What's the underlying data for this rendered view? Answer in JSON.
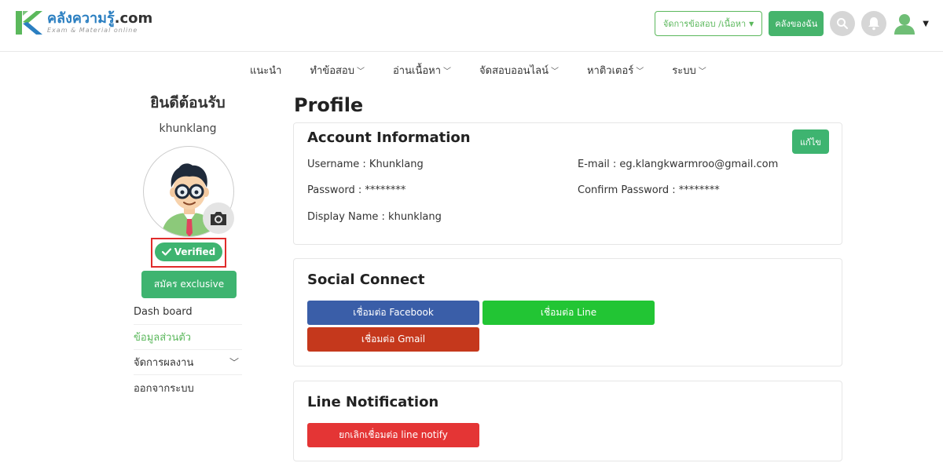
{
  "header": {
    "logo_title_part1": "คลัง",
    "logo_title_part2": "ความรู้",
    "logo_title_part3": ".com",
    "logo_subtitle": "Exam & Material online",
    "manage_button": "จัดการข้อสอบ /เนื้อหา",
    "my_store_button": "คลังของฉัน"
  },
  "nav": {
    "items": [
      {
        "label": "แนะนำ",
        "dropdown": false
      },
      {
        "label": "ทำข้อสอบ",
        "dropdown": true
      },
      {
        "label": "อ่านเนื้อหา",
        "dropdown": true
      },
      {
        "label": "จัดสอบออนไลน์",
        "dropdown": true
      },
      {
        "label": "หาติวเตอร์",
        "dropdown": true
      },
      {
        "label": "ระบบ",
        "dropdown": true
      }
    ]
  },
  "sidebar": {
    "welcome": "ยินดีต้อนรับ",
    "username": "khunklang",
    "verified": "Verified",
    "exclusive_button": "สมัคร exclusive",
    "menu": [
      {
        "label": "Dash board"
      },
      {
        "label": "ข้อมูลส่วนตัว"
      },
      {
        "label": "จัดการผลงาน"
      },
      {
        "label": "ออกจากระบบ"
      }
    ]
  },
  "main": {
    "title": "Profile",
    "account": {
      "title": "Account Information",
      "edit_button": "แก้ไข",
      "username": "Username : Khunklang",
      "password": "Password : ********",
      "display_name": "Display Name : khunklang",
      "email": "E-mail : eg.klangkwarmroo@gmail.com",
      "confirm_password": "Confirm Password : ********"
    },
    "social": {
      "title": "Social Connect",
      "facebook": "เชื่อมต่อ Facebook",
      "line": "เชื่อมต่อ Line",
      "gmail": "เชื่อมต่อ Gmail"
    },
    "line_notify": {
      "title": "Line Notification",
      "button": "ยกเลิกเชื่อมต่อ line notify"
    }
  },
  "colors": {
    "brand_green": "#3eb470",
    "brand_blue": "#2b7fc1",
    "facebook": "#3a5ea8",
    "line": "#22c534",
    "gmail": "#c5381c",
    "danger": "#e43535",
    "highlight_border": "#e02b2b"
  }
}
